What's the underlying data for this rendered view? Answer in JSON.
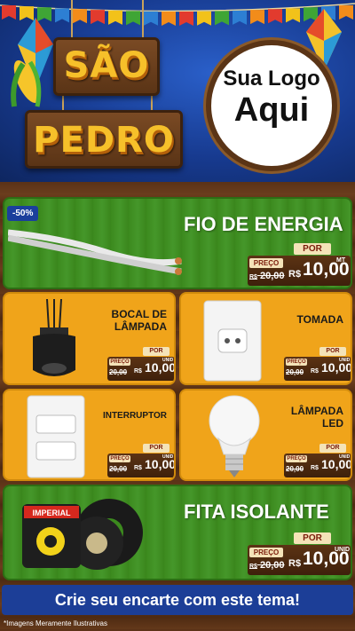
{
  "header": {
    "title_line1": "SÃO",
    "title_line2": "PEDRO",
    "logo_line1": "Sua Logo",
    "logo_line2": "Aqui"
  },
  "colors": {
    "header_blue": "#173a8f",
    "card_green": "#3c8a1e",
    "card_orange": "#f0a41a",
    "banner_blue": "#1c3e97",
    "sign_gold": "#f6c02a"
  },
  "products": {
    "fio": {
      "title": "FIO DE ENERGIA",
      "discount": "-50%",
      "por": "POR",
      "preco": "PREÇO",
      "old": "20,00",
      "old_prefix": "R$",
      "price": "10,00",
      "currency": "R$",
      "unit": "MT"
    },
    "bocal": {
      "title": "BOCAL DE LÂMPADA",
      "por": "POR",
      "preco": "PREÇO",
      "old": "20,00",
      "old_prefix": "R$",
      "price": "10,00",
      "currency": "R$",
      "unit": "UNID"
    },
    "tomada": {
      "title": "TOMADA",
      "por": "POR",
      "preco": "PREÇO",
      "old": "20,00",
      "old_prefix": "R$",
      "price": "10,00",
      "currency": "R$",
      "unit": "UNID"
    },
    "interruptor": {
      "title": "INTERRUPTOR",
      "por": "POR",
      "preco": "PREÇO",
      "old": "20,00",
      "old_prefix": "R$",
      "price": "10,00",
      "currency": "R$",
      "unit": "UNID"
    },
    "lampada": {
      "title": "LÂMPADA LED",
      "por": "POR",
      "preco": "PREÇO",
      "old": "20,00",
      "old_prefix": "R$",
      "price": "10,00",
      "currency": "R$",
      "unit": "UNID"
    },
    "fita": {
      "title": "FITA ISOLANTE",
      "por": "POR",
      "preco": "PREÇO",
      "old": "20,00",
      "old_prefix": "R$",
      "price": "10,00",
      "currency": "R$",
      "unit": "UNID",
      "brand": "IMPERIAL"
    }
  },
  "banner": {
    "text": "Crie seu encarte com este tema!"
  },
  "footnote": "*Imagens Meramente Ilustrativas"
}
